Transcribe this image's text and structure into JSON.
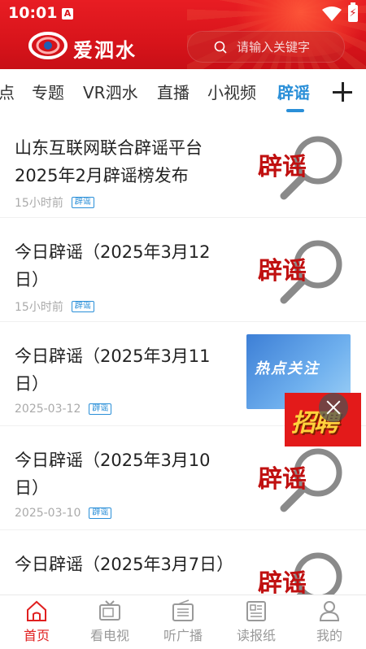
{
  "status_bar": {
    "time": "10:01",
    "battery": "⚡"
  },
  "header": {
    "app_name": "爱泗水",
    "search_placeholder": "请输入关键字"
  },
  "tabs": [
    {
      "label": "点"
    },
    {
      "label": "专题"
    },
    {
      "label": "VR泗水"
    },
    {
      "label": "直播"
    },
    {
      "label": "小视频"
    },
    {
      "label": "辟谣",
      "active": true
    }
  ],
  "articles": [
    {
      "title": "山东互联网联合辟谣平台2025年2月辟谣榜发布",
      "time": "15小时前",
      "tag": "辟谣",
      "thumb": "辟谣"
    },
    {
      "title": "今日辟谣（2025年3月12日）",
      "time": "15小时前",
      "tag": "辟谣",
      "thumb": "辟谣"
    },
    {
      "title": "今日辟谣（2025年3月11日）",
      "time": "2025-03-12",
      "tag": "辟谣",
      "thumb": "热点关注"
    },
    {
      "title": "今日辟谣（2025年3月10日）",
      "time": "2025-03-10",
      "tag": "辟谣",
      "thumb": "辟谣"
    },
    {
      "title": "今日辟谣（2025年3月7日）",
      "time": "",
      "tag": "",
      "thumb": "辟谣"
    }
  ],
  "ad": {
    "text": "招聘"
  },
  "bottom_nav": [
    {
      "label": "首页",
      "active": true
    },
    {
      "label": "看电视"
    },
    {
      "label": "听广播"
    },
    {
      "label": "读报纸"
    },
    {
      "label": "我的"
    }
  ],
  "colors": {
    "brand_red": "#d8141b",
    "accent_blue": "#2a8fd8"
  }
}
